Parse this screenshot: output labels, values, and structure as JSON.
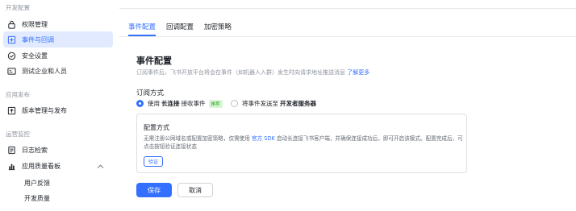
{
  "sidebar": {
    "sections": [
      {
        "title": "开发配置"
      },
      {
        "title": "应用发布"
      },
      {
        "title": "运营监控"
      }
    ],
    "items": [
      {
        "label": "权限管理",
        "icon": "lock-icon"
      },
      {
        "label": "事件与回调",
        "icon": "event-icon",
        "active": true
      },
      {
        "label": "安全设置",
        "icon": "shield-check-icon"
      },
      {
        "label": "测试企业和人员",
        "icon": "test-org-icon"
      },
      {
        "label": "版本管理与发布",
        "icon": "version-icon"
      },
      {
        "label": "日志检索",
        "icon": "log-icon"
      },
      {
        "label": "应用质量看板",
        "icon": "dashboard-icon",
        "expanded": true
      }
    ],
    "sub_items": [
      {
        "label": "用户反馈"
      },
      {
        "label": "开发质量"
      }
    ]
  },
  "tabs": [
    {
      "label": "事件配置",
      "active": true
    },
    {
      "label": "回调配置"
    },
    {
      "label": "加密策略"
    }
  ],
  "main": {
    "title": "事件配置",
    "description": "订阅事件后，飞书开放平台将会在事件（如机器人入群）发生时向请求地址推送消息 ",
    "description_link": "了解更多",
    "subscription": {
      "title": "订阅方式",
      "option1_prefix": "使用",
      "option1_bold": "长连接",
      "option1_suffix": "接收事件",
      "option1_tag": "推荐",
      "option2_prefix": "将事件发送至",
      "option2_bold": "开发者服务器",
      "selected": "option1"
    },
    "panel": {
      "title": "配置方式",
      "text_before": "无需注册公网域名或配置加密策略，仅需使用 ",
      "text_link": "官方 SDK",
      "text_after": " 启动长连接飞书客户端，并确保连接成功后，即可开启该模式。配置完成后，可点击按钮验证连接状态",
      "verify_label": "验证"
    },
    "save_label": "保存",
    "cancel_label": "取消"
  },
  "colors": {
    "accent": "#3370ff",
    "active_bg": "#e1eaff",
    "tag_text": "#2ea121",
    "tag_bg": "#d9f5d6"
  }
}
